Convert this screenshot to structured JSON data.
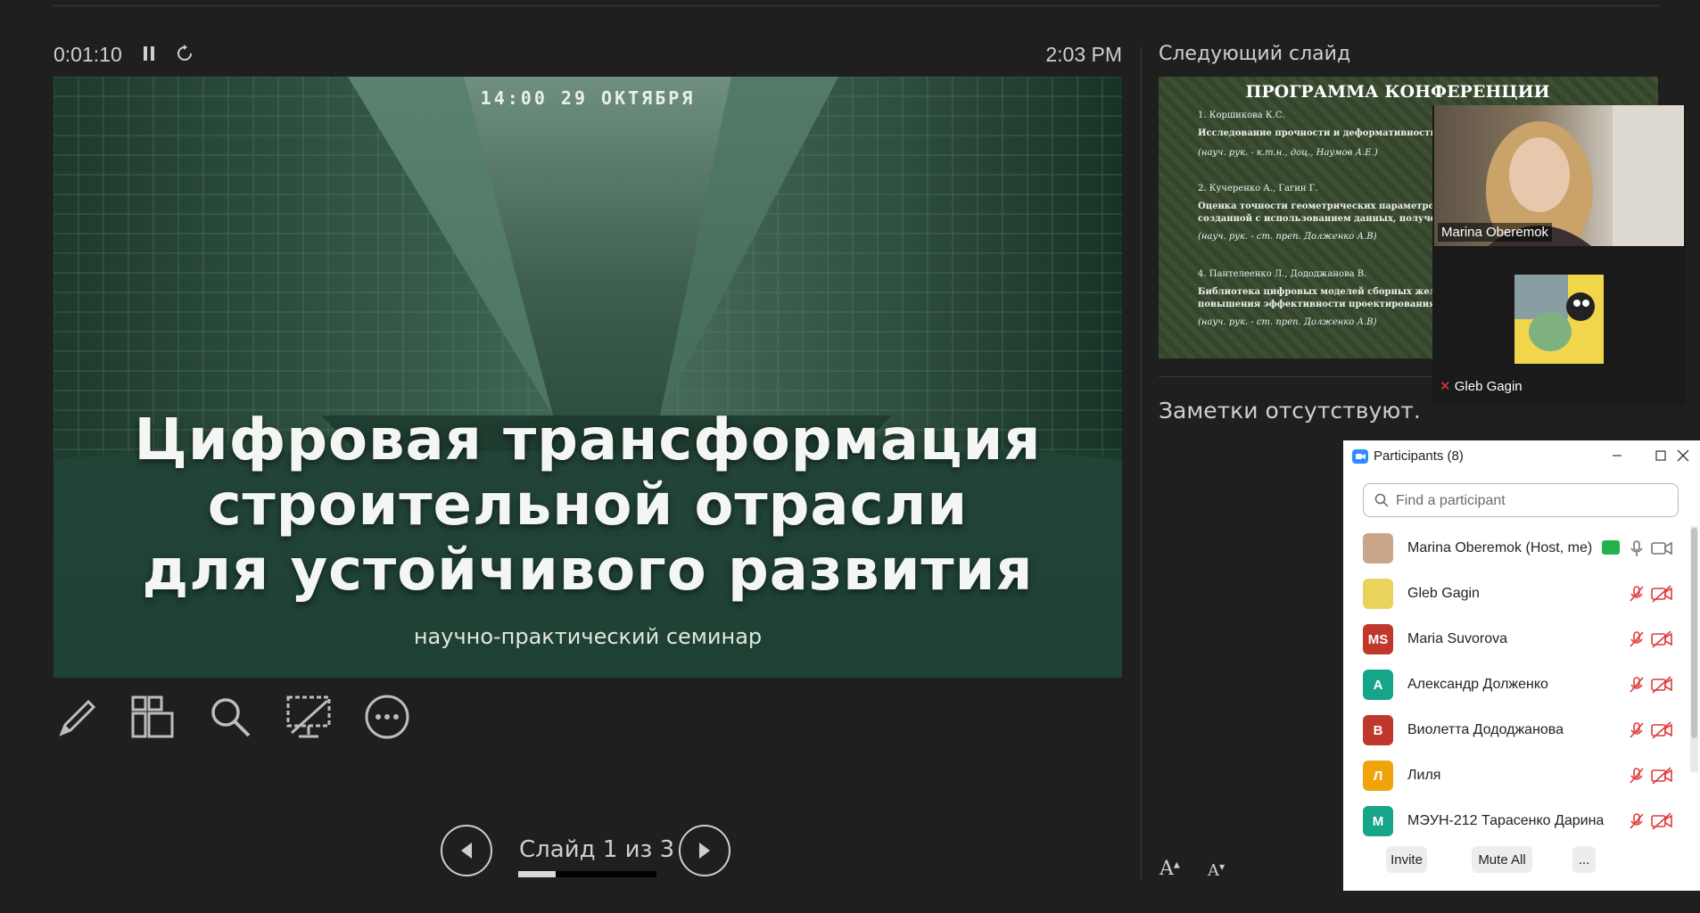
{
  "presenter": {
    "timer": "0:01:10",
    "clock": "2:03 PM",
    "current_slide": {
      "date": "14:00 29 ОКТЯБРЯ",
      "title_lines": [
        "Цифровая трансформация",
        "строительной отрасли",
        "для устойчивого развития"
      ],
      "subtitle": "научно-практический семинар"
    },
    "tools": [
      "pen-icon",
      "slides-grid-icon",
      "zoom-icon",
      "screen-toggle-icon",
      "more-icon"
    ],
    "slide_counter": "Слайд 1 из 3",
    "progress": 0.27
  },
  "next_slide": {
    "label": "Следующий слайд",
    "title": "ПРОГРАММА КОНФЕРЕНЦИИ",
    "items": [
      {
        "author": "1. Коршикова К.С.",
        "topic": "Исследование прочности и деформативности ст",
        "topic2": "",
        "advisor": "(науч. рук. - к.т.н., доц., Наумов А.Е.)"
      },
      {
        "author": "2. Кучеренко А., Гагин Г.",
        "topic": "Оценка точности геометрических параметров ц",
        "topic2": "созданной с использованием данных, получени",
        "advisor": "(науч. рук. - ст. преп. Долженко А.В)"
      },
      {
        "author": "4. Пантелеенко Л., Дододжанова В.",
        "topic": "Библиотека цифровых моделей сборных железо",
        "topic2": "повышения эффективности проектирования об",
        "advisor": "(науч. рук. - ст. преп. Долженко А.В)"
      }
    ]
  },
  "notes": {
    "text": "Заметки отсутствуют.",
    "font_increase": "A",
    "font_decrease": "A"
  },
  "videos": [
    {
      "name": "Marina Oberemok"
    },
    {
      "name": "Gleb Gagin"
    }
  ],
  "participants": {
    "title": "Participants (8)",
    "search_placeholder": "Find a participant",
    "list": [
      {
        "name": "Marina Oberemok (Host, me)",
        "initials": "",
        "color": "#c9a68a"
      },
      {
        "name": "Gleb Gagin",
        "initials": "",
        "color": "#e9d35a"
      },
      {
        "name": "Maria Suvorova",
        "initials": "MS",
        "color": "#c0382b"
      },
      {
        "name": "Александр Долженко",
        "initials": "А",
        "color": "#17a589"
      },
      {
        "name": "Виолетта Дододжанова",
        "initials": "В",
        "color": "#c0382b"
      },
      {
        "name": "Лиля",
        "initials": "Л",
        "color": "#f0a30a"
      },
      {
        "name": "МЭУН-212 Тарасенко Дарина",
        "initials": "М",
        "color": "#17a589"
      }
    ],
    "buttons": {
      "invite": "Invite",
      "mute_all": "Mute All",
      "more": "..."
    }
  }
}
